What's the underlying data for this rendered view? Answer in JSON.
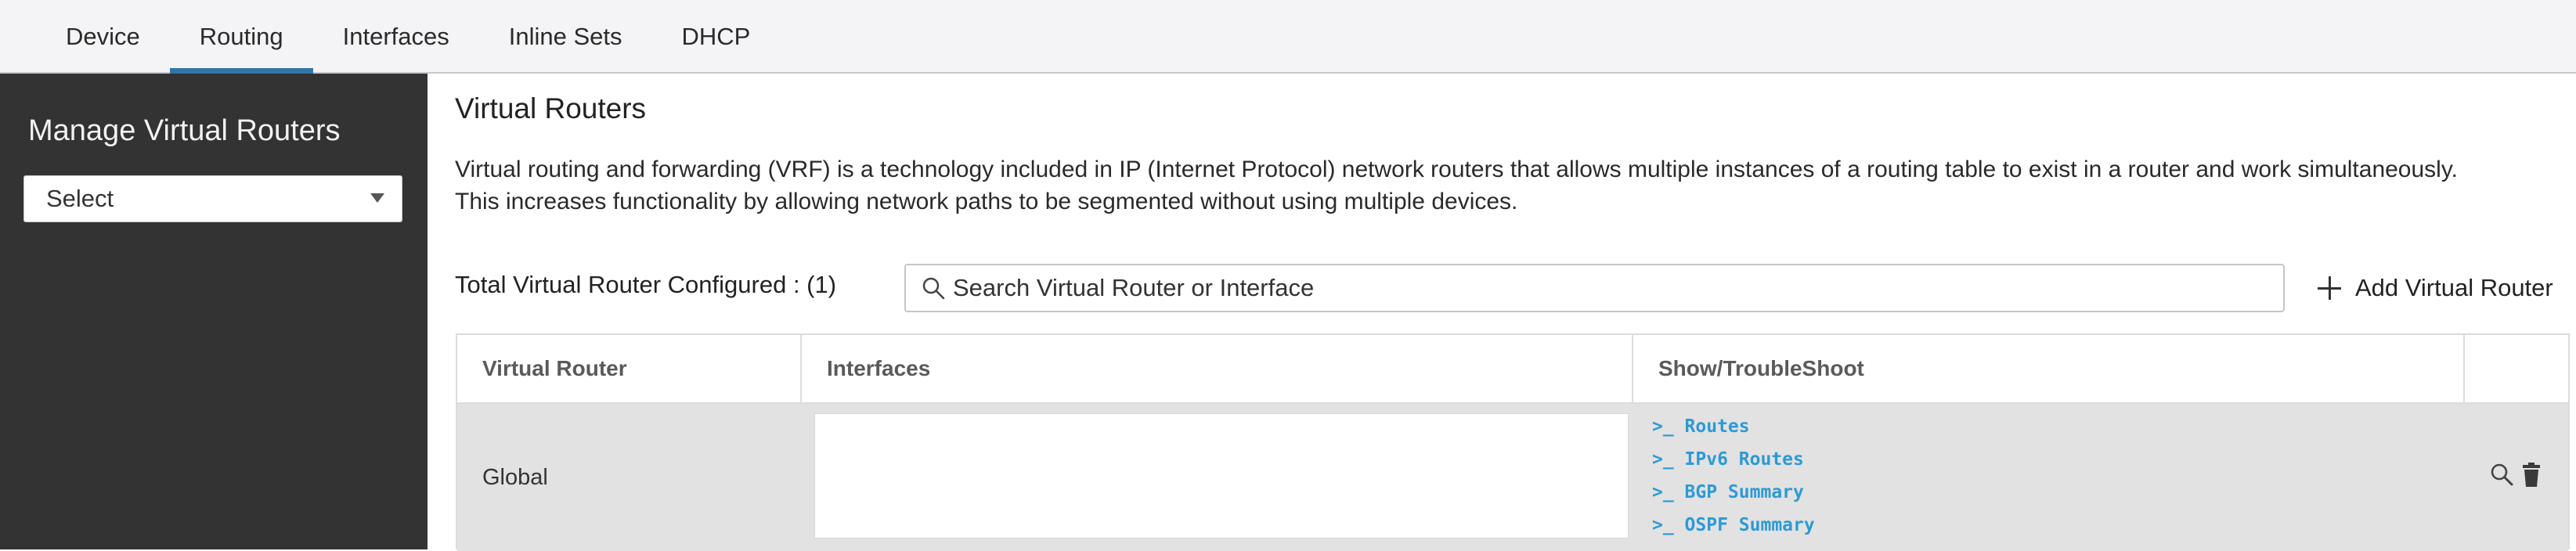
{
  "tabs": [
    {
      "label": "Device",
      "active": false
    },
    {
      "label": "Routing",
      "active": true
    },
    {
      "label": "Interfaces",
      "active": false
    },
    {
      "label": "Inline Sets",
      "active": false
    },
    {
      "label": "DHCP",
      "active": false
    }
  ],
  "sidebar": {
    "title": "Manage Virtual Routers",
    "select_value": "Select"
  },
  "main": {
    "title": "Virtual Routers",
    "description": "Virtual routing and forwarding (VRF) is a technology included in IP (Internet Protocol) network routers that allows multiple instances of a routing table to exist in a router and work simultaneously. This increases functionality by allowing network paths to be segmented without using multiple devices.",
    "total_label": "Total Virtual Router Configured : (1)",
    "search_placeholder": "Search Virtual Router or Interface",
    "add_label": "Add Virtual Router"
  },
  "table": {
    "columns": [
      "Virtual Router",
      "Interfaces",
      "Show/TroubleShoot",
      ""
    ],
    "rows": [
      {
        "virtual_router": "Global",
        "interfaces": "",
        "links": [
          ">_ Routes",
          ">_ IPv6 Routes",
          ">_ BGP Summary",
          ">_ OSPF Summary"
        ]
      }
    ]
  },
  "icons": {
    "search": "search-icon",
    "add": "plus-icon",
    "row_search": "magnifier-icon",
    "row_delete": "trash-icon"
  },
  "colors": {
    "accent": "#3276a8",
    "link": "#2c9ad6",
    "sidebar_bg": "#333333",
    "row_bg": "#e2e2e2"
  }
}
